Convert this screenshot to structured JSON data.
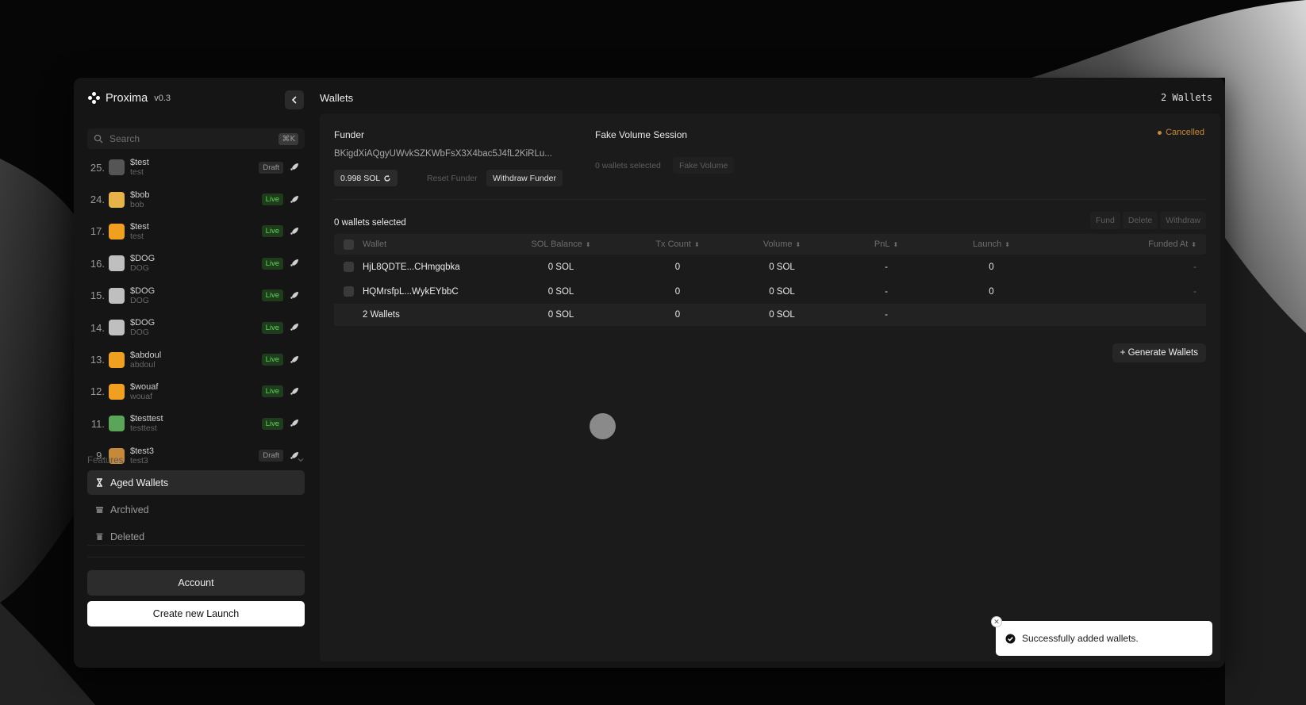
{
  "app": {
    "name": "Proxima",
    "version": "v0.3"
  },
  "search": {
    "placeholder": "Search",
    "shortcut": "⌘K"
  },
  "launches": [
    {
      "num": "25.",
      "ticker": "$test",
      "name": "test",
      "status": "Draft",
      "avatar_color": "#555555"
    },
    {
      "num": "24.",
      "ticker": "$bob",
      "name": "bob",
      "status": "Live",
      "avatar_color": "#e8b24a"
    },
    {
      "num": "17.",
      "ticker": "$test",
      "name": "test",
      "status": "Live",
      "avatar_color": "#f0a020"
    },
    {
      "num": "16.",
      "ticker": "$DOG",
      "name": "DOG",
      "status": "Live",
      "avatar_color": "#bfbfbf"
    },
    {
      "num": "15.",
      "ticker": "$DOG",
      "name": "DOG",
      "status": "Live",
      "avatar_color": "#bfbfbf"
    },
    {
      "num": "14.",
      "ticker": "$DOG",
      "name": "DOG",
      "status": "Live",
      "avatar_color": "#bfbfbf"
    },
    {
      "num": "13.",
      "ticker": "$abdoul",
      "name": "abdoul",
      "status": "Live",
      "avatar_color": "#f0a020"
    },
    {
      "num": "12.",
      "ticker": "$wouaf",
      "name": "wouaf",
      "status": "Live",
      "avatar_color": "#f0a020"
    },
    {
      "num": "11.",
      "ticker": "$testtest",
      "name": "testtest",
      "status": "Live",
      "avatar_color": "#5aa55a"
    },
    {
      "num": "9.",
      "ticker": "$test3",
      "name": "test3",
      "status": "Draft",
      "avatar_color": "#c48a3a"
    }
  ],
  "features": {
    "label": "Features",
    "items": [
      {
        "label": "Aged Wallets",
        "icon": "hourglass-icon",
        "active": true
      },
      {
        "label": "Archived",
        "icon": "archive-icon",
        "active": false
      },
      {
        "label": "Deleted",
        "icon": "trash-icon",
        "active": false
      }
    ]
  },
  "sidebar_buttons": {
    "account": "Account",
    "create": "Create new Launch"
  },
  "header": {
    "title": "Wallets",
    "count": "2 Wallets"
  },
  "funder": {
    "label": "Funder",
    "address": "BKigdXiAQgyUWvkSZKWbFsX3X4bac5J4fL2KiRLu...",
    "balance": "0.998 SOL",
    "reset_label": "Reset Funder",
    "withdraw_label": "Withdraw Funder"
  },
  "fake_volume": {
    "label": "Fake Volume Session",
    "status": "Cancelled",
    "selected": "0 wallets selected",
    "button": "Fake Volume"
  },
  "wallets": {
    "selected_label": "0 wallets selected",
    "actions": [
      "Fund",
      "Delete",
      "Withdraw"
    ],
    "columns": [
      "Wallet",
      "SOL Balance",
      "Tx Count",
      "Volume",
      "PnL",
      "Launch",
      "Funded At"
    ],
    "rows": [
      {
        "wallet": "HjL8QDTE...CHmgqbka",
        "balance": "0 SOL",
        "tx": "0",
        "volume": "0 SOL",
        "pnl": "-",
        "launch": "0",
        "funded": "-"
      },
      {
        "wallet": "HQMrsfpL...WykEYbbC",
        "balance": "0 SOL",
        "tx": "0",
        "volume": "0 SOL",
        "pnl": "-",
        "launch": "0",
        "funded": "-"
      }
    ],
    "totals": {
      "wallet": "2 Wallets",
      "balance": "0 SOL",
      "tx": "0",
      "volume": "0 SOL",
      "pnl": "-"
    },
    "generate_label": "+ Generate Wallets"
  },
  "toast": {
    "message": "Successfully added wallets."
  },
  "colors": {
    "live": "#5fd35a",
    "cancelled": "#c58a3a",
    "accent": "#ffffff"
  }
}
